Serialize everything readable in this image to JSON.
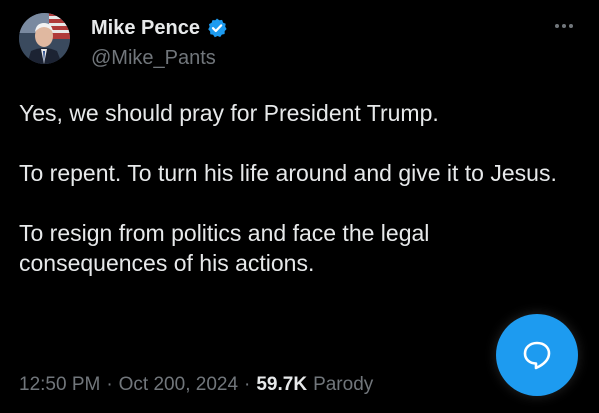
{
  "author": {
    "display_name": "Mike Pence",
    "handle": "@Mike_Pants",
    "verified": true
  },
  "tweet": {
    "paragraphs": [
      "Yes, we should pray for President Trump.",
      "To repent. To turn his life around and give it to Jesus.",
      "To resign from politics and face the legal consequences of his actions."
    ],
    "time": "12:50 PM",
    "separator": "·",
    "date": "Oct 200, 2024",
    "views_count": "59.7K",
    "label": "Parody"
  },
  "icons": {
    "verified": "verified-badge-icon",
    "more": "more-options-icon",
    "fab": "chat-bubble-icon"
  },
  "colors": {
    "background": "#000000",
    "text": "#e7e9ea",
    "secondary_text": "#71767b",
    "accent": "#1d9bf0"
  }
}
